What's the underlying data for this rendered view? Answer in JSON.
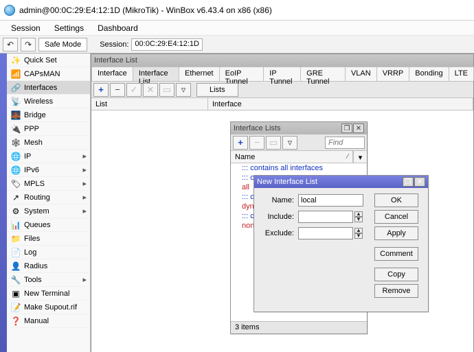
{
  "title": "admin@00:0C:29:E4:12:1D (MikroTik) - WinBox v6.43.4 on x86 (x86)",
  "menubar": {
    "session": "Session",
    "settings": "Settings",
    "dashboard": "Dashboard"
  },
  "toolbar": {
    "safe_mode": "Safe Mode",
    "session_label": "Session:",
    "session_value": "00:0C:29:E4:12:1D"
  },
  "sidebar": {
    "items": [
      {
        "label": "Quick Set",
        "icon": "✨",
        "caret": false
      },
      {
        "label": "CAPsMAN",
        "icon": "📶",
        "caret": false
      },
      {
        "label": "Interfaces",
        "icon": "🔗",
        "caret": false,
        "active": true
      },
      {
        "label": "Wireless",
        "icon": "📡",
        "caret": false
      },
      {
        "label": "Bridge",
        "icon": "🌉",
        "caret": false
      },
      {
        "label": "PPP",
        "icon": "🔌",
        "caret": false
      },
      {
        "label": "Mesh",
        "icon": "🕸",
        "caret": false
      },
      {
        "label": "IP",
        "icon": "🌐",
        "caret": true
      },
      {
        "label": "IPv6",
        "icon": "🌐",
        "caret": true
      },
      {
        "label": "MPLS",
        "icon": "🏷",
        "caret": true
      },
      {
        "label": "Routing",
        "icon": "↗",
        "caret": true
      },
      {
        "label": "System",
        "icon": "⚙",
        "caret": true
      },
      {
        "label": "Queues",
        "icon": "📊",
        "caret": false
      },
      {
        "label": "Files",
        "icon": "📁",
        "caret": false
      },
      {
        "label": "Log",
        "icon": "📄",
        "caret": false
      },
      {
        "label": "Radius",
        "icon": "👤",
        "caret": false
      },
      {
        "label": "Tools",
        "icon": "🔧",
        "caret": true
      },
      {
        "label": "New Terminal",
        "icon": "▣",
        "caret": false
      },
      {
        "label": "Make Supout.rif",
        "icon": "📝",
        "caret": false
      },
      {
        "label": "Manual",
        "icon": "❓",
        "caret": false
      }
    ]
  },
  "interface_list_window": {
    "title": "Interface List",
    "tabs": [
      "Interface",
      "Interface List",
      "Ethernet",
      "EoIP Tunnel",
      "IP Tunnel",
      "GRE Tunnel",
      "VLAN",
      "VRRP",
      "Bonding",
      "LTE"
    ],
    "active_tab": "Interface List",
    "lists_btn": "Lists",
    "columns": {
      "list": "List",
      "interface": "Interface"
    }
  },
  "interface_lists_window": {
    "title": "Interface Lists",
    "find_placeholder": "Find",
    "name_col": "Name",
    "rows": [
      {
        "desc": "::: contains all interfaces",
        "name": ""
      },
      {
        "desc": "::: c",
        "name": "all"
      },
      {
        "desc": "::: c",
        "name": "dyna"
      },
      {
        "desc": "::: c",
        "name": ""
      },
      {
        "desc": "",
        "name": "none"
      }
    ],
    "status": "3 items"
  },
  "new_interface_list_dialog": {
    "title": "New Interface List",
    "name_label": "Name:",
    "name_value": "local",
    "include_label": "Include:",
    "exclude_label": "Exclude:",
    "buttons": {
      "ok": "OK",
      "cancel": "Cancel",
      "apply": "Apply",
      "comment": "Comment",
      "copy": "Copy",
      "remove": "Remove"
    }
  }
}
